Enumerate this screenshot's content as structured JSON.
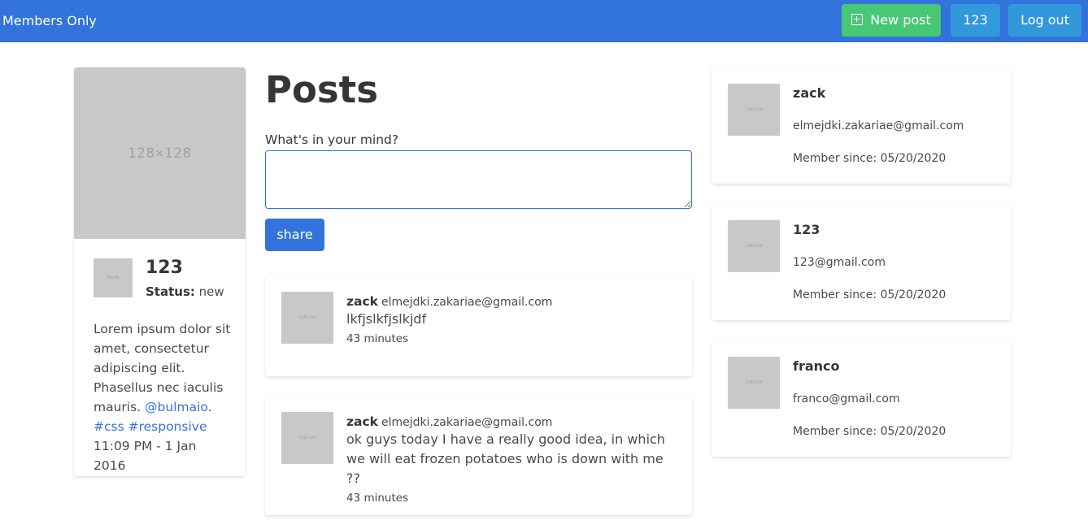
{
  "navbar": {
    "brand": "Members Only",
    "new_post_label": "New post",
    "new_post_icon": "plus-square-icon",
    "user_label": "123",
    "logout_label": "Log out",
    "colors": {
      "navbar": "#3273dc",
      "new_post": "#48c774",
      "secondary": "#3298dc"
    }
  },
  "profile": {
    "image_text": "128×128",
    "avatar_text": "96×96",
    "name": "123",
    "status_label": "Status:",
    "status_value": "new",
    "bio_text": "Lorem ipsum dolor sit amet, consectetur adipiscing elit. Phasellus nec iaculis mauris.",
    "bio_mention": "@bulmaio",
    "bio_period": ".",
    "bio_tag_css": "#css",
    "bio_tag_responsive": "#responsive",
    "bio_timestamp": "11:09 PM - 1 Jan 2016"
  },
  "posts": {
    "title": "Posts",
    "form_label": "What's in your mind?",
    "textarea_value": "",
    "share_label": "share",
    "items": [
      {
        "avatar_text": "128×128",
        "author": "zack",
        "email": "elmejdki.zakariae@gmail.com",
        "content": "lkfjslkfjslkjdf",
        "time": "43 minutes"
      },
      {
        "avatar_text": "128×128",
        "author": "zack",
        "email": "elmejdki.zakariae@gmail.com",
        "content": "ok guys today I have a really good idea, in which we will eat frozen potatoes who is down with me ??",
        "time": "43 minutes"
      }
    ]
  },
  "members": [
    {
      "avatar_text": "128×128",
      "name": "zack",
      "email": "elmejdki.zakariae@gmail.com",
      "since": "Member since: 05/20/2020"
    },
    {
      "avatar_text": "128×128",
      "name": "123",
      "email": "123@gmail.com",
      "since": "Member since: 05/20/2020"
    },
    {
      "avatar_text": "128×128",
      "name": "franco",
      "email": "franco@gmail.com",
      "since": "Member since: 05/20/2020"
    }
  ]
}
